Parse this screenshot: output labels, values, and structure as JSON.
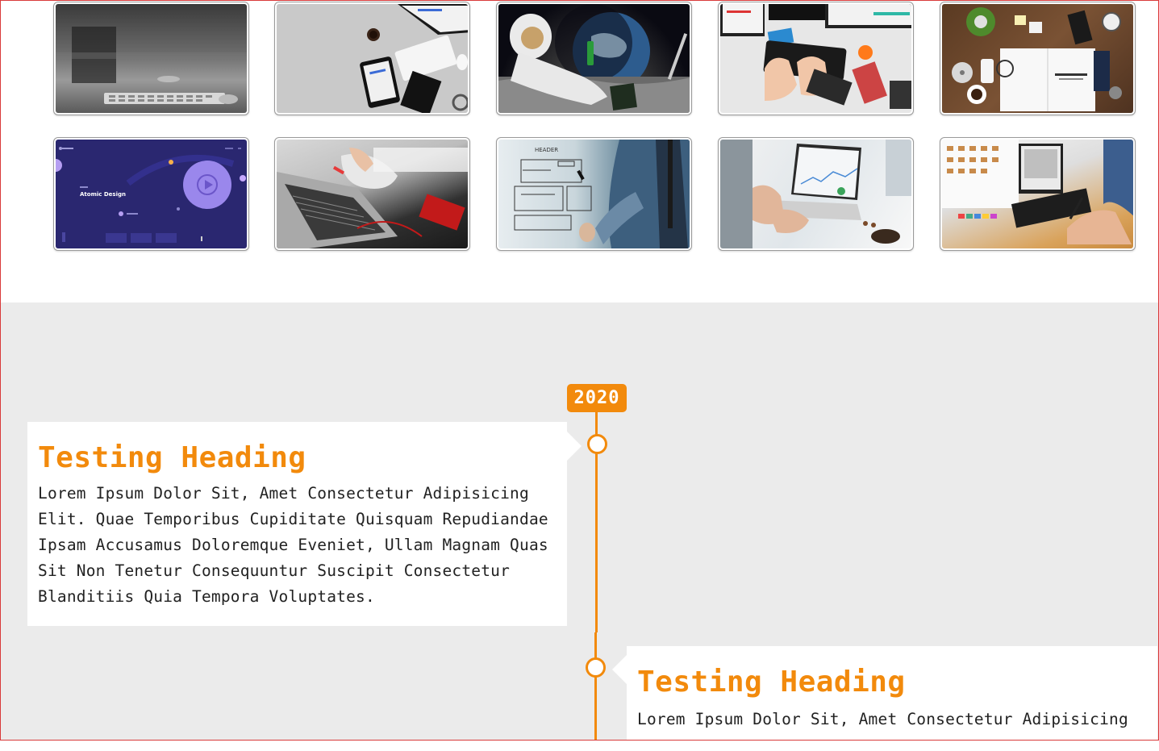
{
  "gallery": {
    "thumbnails": [
      {
        "label": "laptop-keyboard-mono"
      },
      {
        "label": "desk-flatlay-monitor-tablet"
      },
      {
        "label": "astronaut-on-moon"
      },
      {
        "label": "hands-typing-keyboard-desk"
      },
      {
        "label": "business-desk-notebook"
      },
      {
        "label": "atomic-design-ui",
        "caption": "Atomic Design"
      },
      {
        "label": "laptop-writing-desk"
      },
      {
        "label": "wireframe-drawing-glass"
      },
      {
        "label": "laptop-analytics-coffee"
      },
      {
        "label": "designer-workstation-swatches"
      }
    ]
  },
  "timeline": {
    "year": "2020",
    "entries": [
      {
        "heading": "Testing Heading",
        "body": "Lorem Ipsum Dolor Sit, Amet Consectetur Adipisicing Elit. Quae Temporibus Cupiditate Quisquam Repudiandae Ipsam Accusamus Doloremque Eveniet, Ullam Magnam Quas Sit Non Tenetur Consequuntur Suscipit Consectetur Blanditiis Quia Tempora Voluptates."
      },
      {
        "heading": "Testing Heading",
        "body": "Lorem Ipsum Dolor Sit, Amet Consectetur Adipisicing"
      }
    ]
  },
  "colors": {
    "accent": "#f28a0c",
    "section_bg": "#ebebeb",
    "card_bg": "#ffffff",
    "frame": "#d93a3a"
  }
}
